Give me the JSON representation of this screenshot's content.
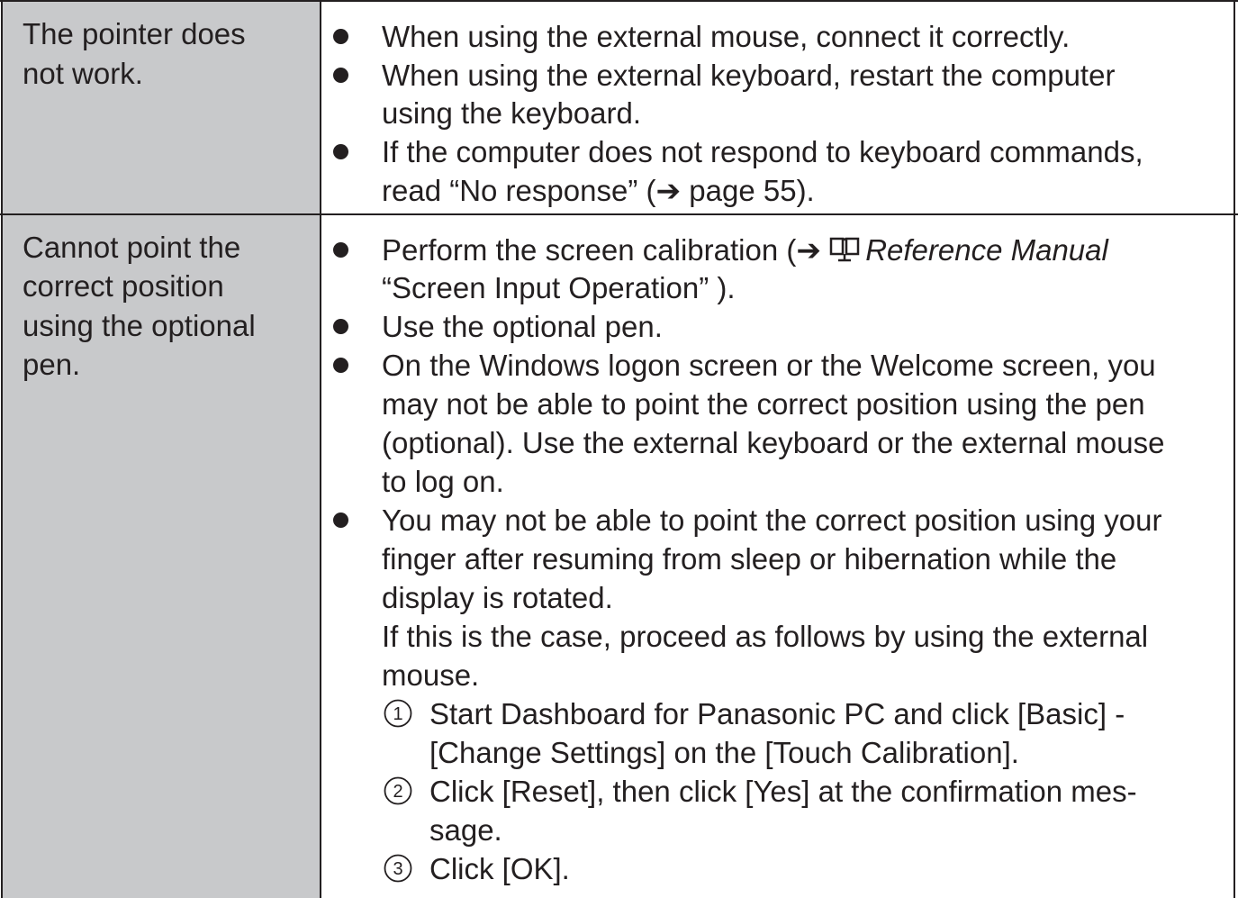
{
  "rows": [
    {
      "symptom": [
        "The pointer does",
        "not work."
      ],
      "lines": [
        "When using the external mouse, connect it correctly.",
        "When using the external keyboard, restart the computer",
        "using the keyboard.",
        "If the computer does not respond to keyboard commands,",
        "read “No response” (➔ page 55)."
      ]
    },
    {
      "symptom": [
        "Cannot point the",
        "correct position",
        "using the optional",
        "pen."
      ],
      "calibration": {
        "prefix": "Perform the screen calibration (➔ ",
        "manual": "Reference Manual",
        "cont": "“Screen Input Operation” )."
      },
      "lines": [
        "Use the optional pen.",
        "On the Windows logon screen or the Welcome screen, you",
        "may not be able to point the correct position using the pen",
        "(optional). Use the external keyboard or the external mouse",
        "to log on.",
        "You may not be able to point the correct position using your",
        "finger after resuming from sleep or hibernation while the",
        "display is rotated.",
        "If this is the case, proceed as follows by using the external",
        "mouse."
      ],
      "steps": [
        {
          "num": "1",
          "lines": [
            "Start Dashboard for Panasonic PC and click [Basic] -",
            "[Change Settings] on the [Touch Calibration]."
          ]
        },
        {
          "num": "2",
          "lines": [
            "Click [Reset], then click [Yes] at the confirmation mes-",
            "sage."
          ]
        },
        {
          "num": "3",
          "lines": [
            "Click [OK]."
          ]
        }
      ]
    }
  ]
}
